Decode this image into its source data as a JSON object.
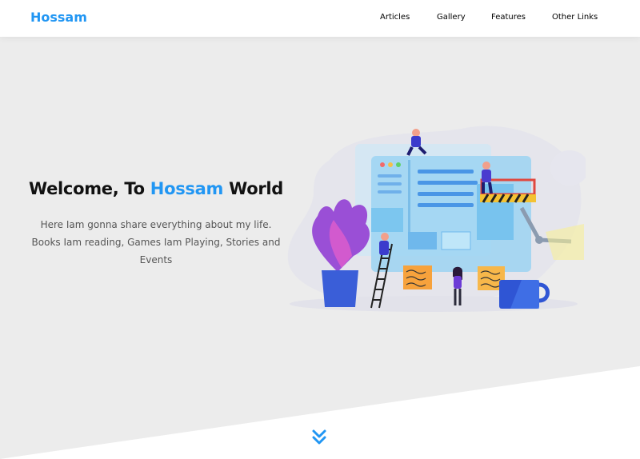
{
  "header": {
    "logo": "Hossam",
    "nav": [
      {
        "label": "Articles"
      },
      {
        "label": "Gallery"
      },
      {
        "label": "Features"
      },
      {
        "label": "Other Links"
      }
    ]
  },
  "landing": {
    "title_prefix": "Welcome, To ",
    "title_accent": "Hossam",
    "title_suffix": " World",
    "description": "Here Iam gonna share everything about my life. Books Iam reading, Games Iam Playing, Stories and Events"
  },
  "icons": {
    "illustration": "web-design-team-illustration",
    "scroll_down": "double-chevron-down-icon"
  },
  "colors": {
    "accent": "#2196f3",
    "landing_bg": "#ececec",
    "text_dark": "#111111",
    "text_muted": "#555555"
  }
}
